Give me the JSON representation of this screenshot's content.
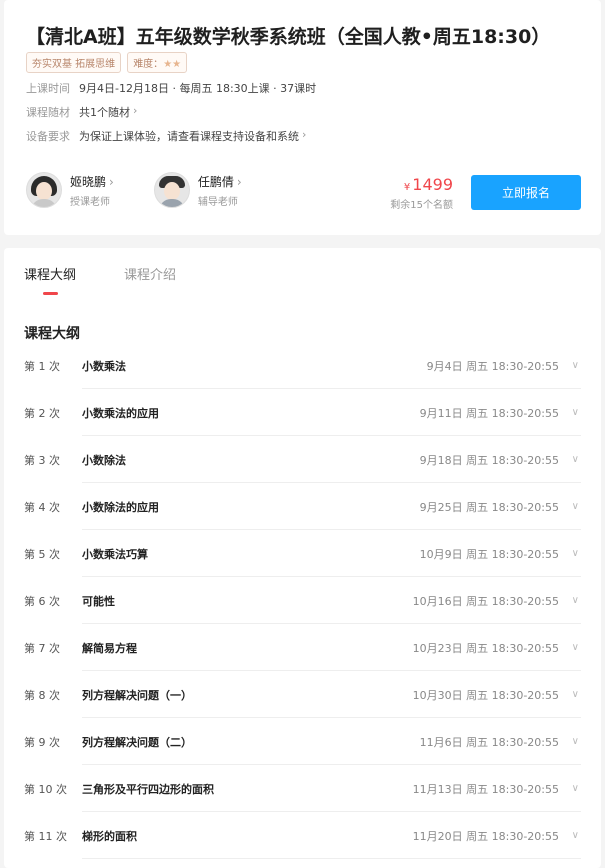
{
  "course": {
    "title": "【清北A班】五年级数学秋季系统班（全国人教•周五18:30）",
    "tags": [
      "夯实双基 拓展思维"
    ],
    "difficulty_label": "难度：",
    "difficulty_stars": "★★",
    "info": [
      {
        "key": "上课时间",
        "value": "9月4日-12月18日 · 每周五 18:30上课 · 37课时",
        "has_chevron": false
      },
      {
        "key": "课程随材",
        "value": "共1个随材",
        "has_chevron": true
      },
      {
        "key": "设备要求",
        "value": "为保证上课体验，请查看课程支持设备和系统",
        "has_chevron": true
      }
    ],
    "teachers": [
      {
        "name": "姬晓鹏",
        "role": "授课老师"
      },
      {
        "name": "任鹏倩",
        "role": "辅导老师"
      }
    ],
    "price_symbol": "¥",
    "price": "1499",
    "remaining": "剩余15个名额",
    "signup_label": "立即报名"
  },
  "tabs": [
    {
      "label": "课程大纲",
      "active": true
    },
    {
      "label": "课程介绍",
      "active": false
    }
  ],
  "outline_title": "课程大纲",
  "lessons": [
    {
      "index": "第 1 次",
      "name": "小数乘法",
      "time": "9月4日 周五 18:30-20:55"
    },
    {
      "index": "第 2 次",
      "name": "小数乘法的应用",
      "time": "9月11日 周五 18:30-20:55"
    },
    {
      "index": "第 3 次",
      "name": "小数除法",
      "time": "9月18日 周五 18:30-20:55"
    },
    {
      "index": "第 4 次",
      "name": "小数除法的应用",
      "time": "9月25日 周五 18:30-20:55"
    },
    {
      "index": "第 5 次",
      "name": "小数乘法巧算",
      "time": "10月9日 周五 18:30-20:55"
    },
    {
      "index": "第 6 次",
      "name": "可能性",
      "time": "10月16日 周五 18:30-20:55"
    },
    {
      "index": "第 7 次",
      "name": "解简易方程",
      "time": "10月23日 周五 18:30-20:55"
    },
    {
      "index": "第 8 次",
      "name": "列方程解决问题（一）",
      "time": "10月30日 周五 18:30-20:55"
    },
    {
      "index": "第 9 次",
      "name": "列方程解决问题（二）",
      "time": "11月6日 周五 18:30-20:55"
    },
    {
      "index": "第 10 次",
      "name": "三角形及平行四边形的面积",
      "time": "11月13日 周五 18:30-20:55"
    },
    {
      "index": "第 11 次",
      "name": "梯形的面积",
      "time": "11月20日 周五 18:30-20:55"
    }
  ],
  "colors": {
    "accent": "#19a3ff",
    "price": "#f0464b"
  }
}
